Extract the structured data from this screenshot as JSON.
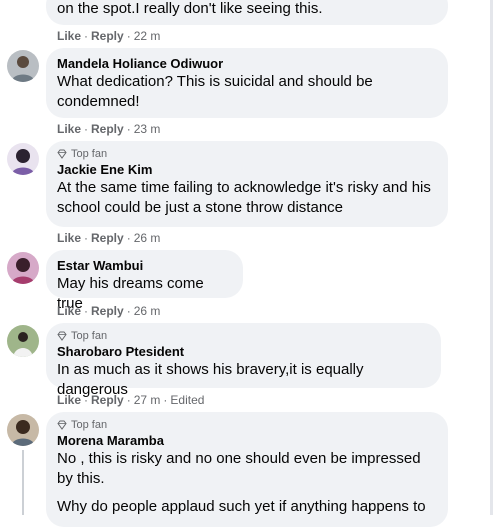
{
  "comments": [
    {
      "name": "",
      "text": "on the spot.I really don't like seeing this.",
      "like": "Like",
      "reply": "Reply",
      "time": "22 m"
    },
    {
      "name": "Mandela Holiance Odiwuor",
      "text": "What dedication? This is suicidal and should be condemned!",
      "like": "Like",
      "reply": "Reply",
      "time": "23 m"
    },
    {
      "badge": "Top fan",
      "name": "Jackie Ene Kim",
      "text": "At the same time failing to acknowledge it's risky and his school could be just a stone throw distance",
      "like": "Like",
      "reply": "Reply",
      "time": "26 m"
    },
    {
      "name": "Estar Wambui",
      "text": "May his dreams come true",
      "like": "Like",
      "reply": "Reply",
      "time": "26 m"
    },
    {
      "badge": "Top fan",
      "name": "Sharobaro Ptesident",
      "text": "In as much as it shows his bravery,it is equally dangerous",
      "like": "Like",
      "reply": "Reply",
      "time": "27 m",
      "edited": "Edited"
    },
    {
      "badge": "Top fan",
      "name": "Morena Maramba",
      "text": "No , this is risky and no one should even be impressed by this.",
      "text2": "Why do people applaud such yet if anything happens to"
    }
  ],
  "separator": "·",
  "colors": {
    "bubble": "#f0f2f5",
    "meta": "#65676b",
    "text": "#050505"
  },
  "icons": {
    "badge": "diamond-icon"
  }
}
